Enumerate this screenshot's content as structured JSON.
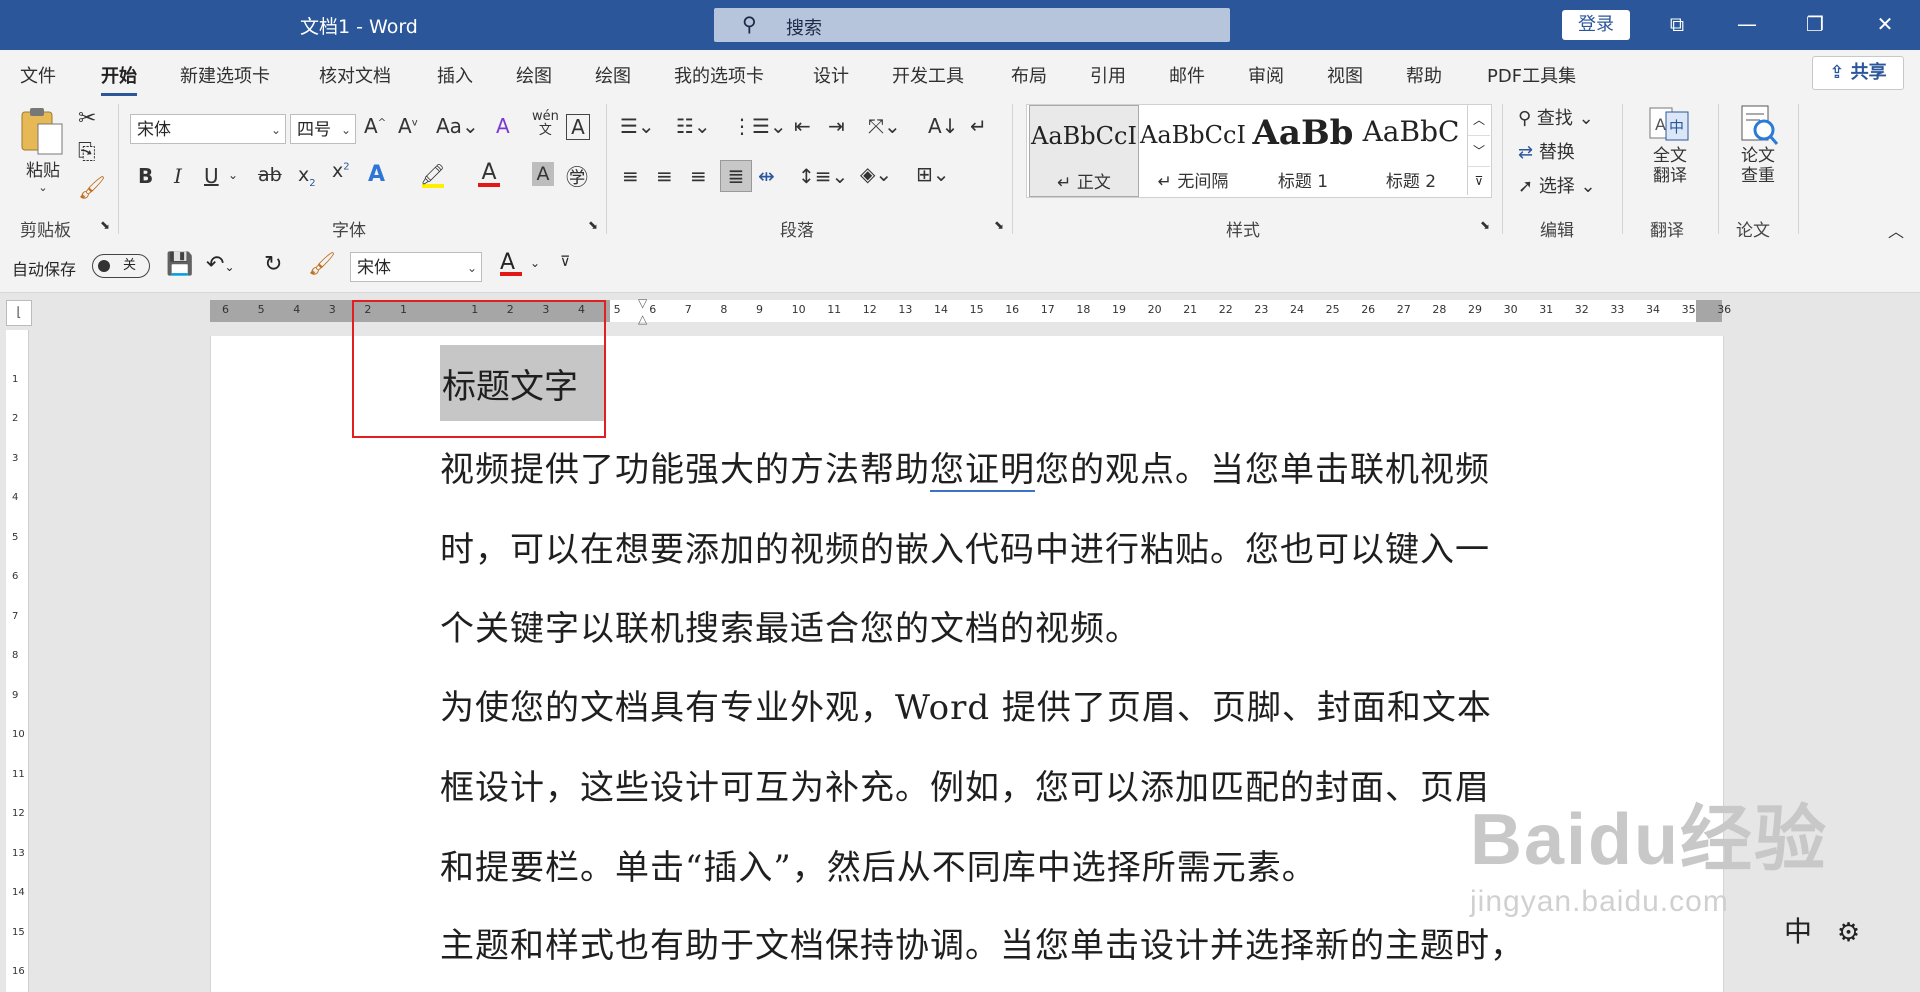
{
  "titlebar": {
    "title": "文档1  -  Word",
    "search_placeholder": "搜索",
    "login": "登录"
  },
  "tabs": [
    "文件",
    "开始",
    "新建选项卡",
    "核对文档",
    "插入",
    "绘图",
    "绘图",
    "我的选项卡",
    "设计",
    "开发工具",
    "布局",
    "引用",
    "邮件",
    "审阅",
    "视图",
    "帮助",
    "PDF工具集"
  ],
  "active_tab": "开始",
  "share": "共享",
  "ribbon": {
    "clipboard": {
      "paste": "粘贴",
      "label": "剪贴板"
    },
    "font": {
      "name": "宋体",
      "size": "四号",
      "label": "字体"
    },
    "paragraph": {
      "label": "段落"
    },
    "styles": {
      "label": "样式",
      "items": [
        {
          "preview": "AaBbCcI",
          "name": "↵ 正文"
        },
        {
          "preview": "AaBbCcI",
          "name": "↵ 无间隔"
        },
        {
          "preview": "AaBb",
          "name": "标题 1"
        },
        {
          "preview": "AaBbC",
          "name": "标题 2"
        }
      ]
    },
    "editing": {
      "find": "查找",
      "replace": "替换",
      "select": "选择",
      "label": "编辑"
    },
    "translate": {
      "button": "全文\n翻译",
      "label": "翻译"
    },
    "paper": {
      "button": "论文\n查重",
      "label": "论文"
    }
  },
  "qat": {
    "autosave": "自动保存",
    "toggle": "关",
    "font": "宋体"
  },
  "document": {
    "heading": "标题文字",
    "lines": [
      "视频提供了功能强大的方法帮助您证明您的观点。当您单击联机视频",
      "时，可以在想要添加的视频的嵌入代码中进行粘贴。您也可以键入一",
      "个关键字以联机搜索最适合您的文档的视频。",
      "为使您的文档具有专业外观，Word 提供了页眉、页脚、封面和文本",
      "框设计，这些设计可互为补充。例如，您可以添加匹配的封面、页眉",
      "和提要栏。单击“插入”，然后从不同库中选择所需元素。",
      "主题和样式也有助于文档保持协调。当您单击设计并选择新的主题时，"
    ]
  },
  "ruler_numbers": [
    "6",
    "5",
    "4",
    "3",
    "2",
    "1",
    "",
    "1",
    "2",
    "3",
    "4",
    "5",
    "6",
    "7",
    "8",
    "9",
    "10",
    "11",
    "12",
    "13",
    "14",
    "15",
    "16",
    "17",
    "18",
    "19",
    "20",
    "21",
    "22",
    "23",
    "24",
    "25",
    "26",
    "27",
    "28",
    "29",
    "30",
    "31",
    "32",
    "33",
    "34",
    "35",
    "36"
  ],
  "watermark": {
    "big": "Baidu经验",
    "small": "jingyan.baidu.com"
  },
  "ime": "中"
}
